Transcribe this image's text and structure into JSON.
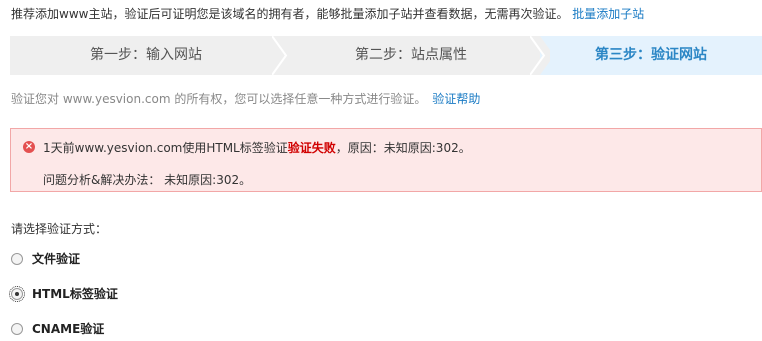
{
  "intro": {
    "text": "推荐添加www主站，验证后可证明您是该域名的拥有者，能够批量添加子站并查看数据，无需再次验证。",
    "link": "批量添加子站"
  },
  "steps": [
    {
      "label": "第一步：输入网站",
      "state": "done"
    },
    {
      "label": "第二步：站点属性",
      "state": "done"
    },
    {
      "label": "第三步：验证网站",
      "state": "active"
    }
  ],
  "verify": {
    "text": "验证您对 www.yesvion.com 的所有权，您可以选择任意一种方式进行验证。",
    "help_link": "验证帮助"
  },
  "error": {
    "prefix": "1天前www.yesvion.com使用HTML标签验证",
    "fail": "验证失败",
    "suffix": "，原因：未知原因:302。",
    "analysis": "问题分析&解决办法：  未知原因:302。"
  },
  "method": {
    "prompt": "请选择验证方式：",
    "options": [
      {
        "label": "文件验证",
        "checked": false
      },
      {
        "label": "HTML标签验证",
        "checked": true
      },
      {
        "label": "CNAME验证",
        "checked": false
      }
    ]
  },
  "colors": {
    "link": "#1a7bc4",
    "active_step_bg": "#e4f2fd",
    "error_bg": "#fde8e8",
    "error_text": "#d00000"
  }
}
